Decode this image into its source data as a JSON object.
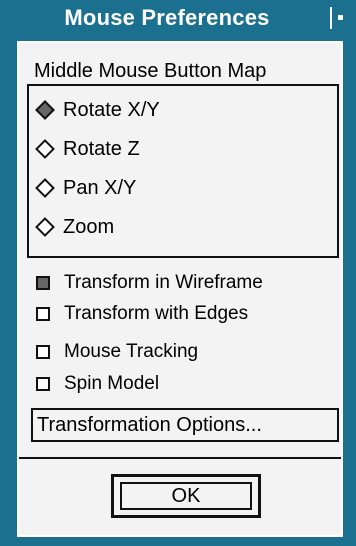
{
  "window": {
    "title": "Mouse Preferences",
    "menu_icon": "window-menu-icon"
  },
  "middle_button_map": {
    "label": "Middle Mouse Button Map",
    "options": [
      {
        "label": "Rotate X/Y",
        "selected": true
      },
      {
        "label": "Rotate Z",
        "selected": false
      },
      {
        "label": "Pan X/Y",
        "selected": false
      },
      {
        "label": "Zoom",
        "selected": false
      }
    ]
  },
  "checkboxes": [
    {
      "label": "Transform in Wireframe",
      "checked": true
    },
    {
      "label": "Transform with Edges",
      "checked": false
    },
    {
      "label": "Mouse Tracking",
      "checked": false
    },
    {
      "label": "Spin Model",
      "checked": false
    }
  ],
  "buttons": {
    "transformation_options": "Transformation Options...",
    "ok": "OK"
  },
  "colors": {
    "title_bar": "#1b6f8f",
    "panel": "#f3f3f3",
    "selected_indicator": "#666666"
  }
}
